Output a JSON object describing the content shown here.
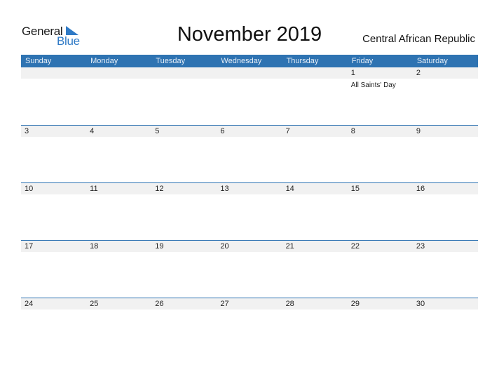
{
  "logo": {
    "general": "General",
    "blue": "Blue",
    "icon": "blue-triangle-flag-icon"
  },
  "title": "November 2019",
  "country": "Central African Republic",
  "colors": {
    "header_bg": "#2e73b2",
    "day_band": "#f1f1f1",
    "brand_blue": "#2f7ac6"
  },
  "weekdays": [
    "Sunday",
    "Monday",
    "Tuesday",
    "Wednesday",
    "Thursday",
    "Friday",
    "Saturday"
  ],
  "weeks": [
    [
      {
        "day": "",
        "event": ""
      },
      {
        "day": "",
        "event": ""
      },
      {
        "day": "",
        "event": ""
      },
      {
        "day": "",
        "event": ""
      },
      {
        "day": "",
        "event": ""
      },
      {
        "day": "1",
        "event": "All Saints' Day"
      },
      {
        "day": "2",
        "event": ""
      }
    ],
    [
      {
        "day": "3",
        "event": ""
      },
      {
        "day": "4",
        "event": ""
      },
      {
        "day": "5",
        "event": ""
      },
      {
        "day": "6",
        "event": ""
      },
      {
        "day": "7",
        "event": ""
      },
      {
        "day": "8",
        "event": ""
      },
      {
        "day": "9",
        "event": ""
      }
    ],
    [
      {
        "day": "10",
        "event": ""
      },
      {
        "day": "11",
        "event": ""
      },
      {
        "day": "12",
        "event": ""
      },
      {
        "day": "13",
        "event": ""
      },
      {
        "day": "14",
        "event": ""
      },
      {
        "day": "15",
        "event": ""
      },
      {
        "day": "16",
        "event": ""
      }
    ],
    [
      {
        "day": "17",
        "event": ""
      },
      {
        "day": "18",
        "event": ""
      },
      {
        "day": "19",
        "event": ""
      },
      {
        "day": "20",
        "event": ""
      },
      {
        "day": "21",
        "event": ""
      },
      {
        "day": "22",
        "event": ""
      },
      {
        "day": "23",
        "event": ""
      }
    ],
    [
      {
        "day": "24",
        "event": ""
      },
      {
        "day": "25",
        "event": ""
      },
      {
        "day": "26",
        "event": ""
      },
      {
        "day": "27",
        "event": ""
      },
      {
        "day": "28",
        "event": ""
      },
      {
        "day": "29",
        "event": ""
      },
      {
        "day": "30",
        "event": ""
      }
    ]
  ]
}
